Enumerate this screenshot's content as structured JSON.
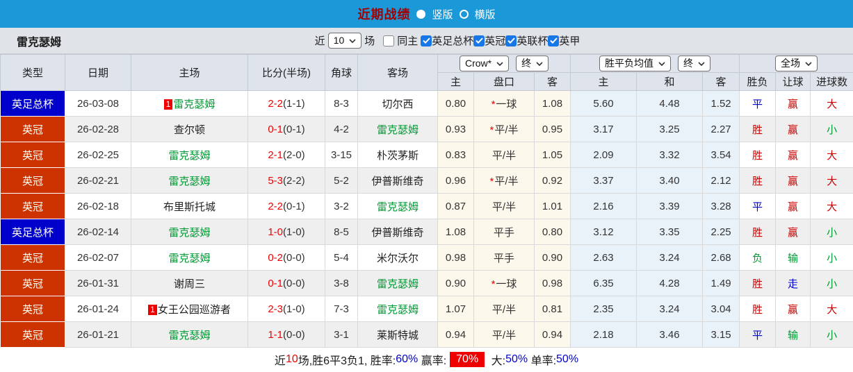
{
  "colors": {
    "topbar_blue": "#1b98d8",
    "title_red": "#a30000",
    "league_cup_blue": "#0000cc",
    "league_championship_red": "#cc3300",
    "team_highlight_green": "#009933",
    "score_red": "#ee0000",
    "result_red": "#cc0000",
    "result_blue": "#0000cc",
    "result_green": "#009933",
    "odds_cell_bg": "#fdf8ec",
    "avg_cell_bg": "#eaf2f9",
    "win_rate_badge_bg": "#ee0000"
  },
  "topbar": {
    "title": "近期战绩",
    "radio_vertical": "竖版",
    "radio_horizontal": "横版",
    "selected": "竖版"
  },
  "filter": {
    "team": "雷克瑟姆",
    "near_label": "近",
    "count_value": "10",
    "games_label": "场",
    "same_home_label": "同主",
    "same_home_checked": false,
    "leagues": [
      {
        "label": "英足总杯",
        "checked": true
      },
      {
        "label": "英冠",
        "checked": true
      },
      {
        "label": "英联杯",
        "checked": true
      },
      {
        "label": "英甲",
        "checked": true
      }
    ]
  },
  "table": {
    "main_headers": [
      "类型",
      "日期",
      "主场",
      "比分(半场)",
      "角球",
      "客场"
    ],
    "dropdowns": {
      "odds_company": "Crow*",
      "odds_final": "终",
      "avg_label": "胜平负均值",
      "avg_final": "终",
      "fulltime": "全场"
    },
    "sub_headers": [
      "主",
      "盘口",
      "客",
      "主",
      "和",
      "客",
      "胜负",
      "让球",
      "进球数"
    ],
    "rows": [
      {
        "league": "英足总杯",
        "league_type": "cup",
        "date": "26-03-08",
        "home": {
          "name": "雷克瑟姆",
          "rank": "1",
          "highlight": true
        },
        "score": "2-2",
        "half": "(1-1)",
        "corners": "8-3",
        "away": {
          "name": "切尔西",
          "rank": "",
          "highlight": false
        },
        "odds_home": "0.80",
        "handicap": {
          "text": "一球",
          "star": true
        },
        "odds_away": "1.08",
        "avg": [
          "5.60",
          "4.48",
          "1.52"
        ],
        "outcome": [
          {
            "t": "平",
            "c": "blue"
          },
          {
            "t": "赢",
            "c": "red"
          },
          {
            "t": "大",
            "c": "red"
          }
        ]
      },
      {
        "league": "英冠",
        "league_type": "chp",
        "date": "26-02-28",
        "home": {
          "name": "查尔顿",
          "rank": "",
          "highlight": false
        },
        "score": "0-1",
        "half": "(0-1)",
        "corners": "4-2",
        "away": {
          "name": "雷克瑟姆",
          "rank": "",
          "highlight": true
        },
        "odds_home": "0.93",
        "handicap": {
          "text": "平/半",
          "star": true
        },
        "odds_away": "0.95",
        "avg": [
          "3.17",
          "3.25",
          "2.27"
        ],
        "outcome": [
          {
            "t": "胜",
            "c": "red"
          },
          {
            "t": "赢",
            "c": "red"
          },
          {
            "t": "小",
            "c": "green"
          }
        ]
      },
      {
        "league": "英冠",
        "league_type": "chp",
        "date": "26-02-25",
        "home": {
          "name": "雷克瑟姆",
          "rank": "",
          "highlight": true
        },
        "score": "2-1",
        "half": "(2-0)",
        "corners": "3-15",
        "away": {
          "name": "朴茨茅斯",
          "rank": "",
          "highlight": false
        },
        "odds_home": "0.83",
        "handicap": {
          "text": "平/半",
          "star": false
        },
        "odds_away": "1.05",
        "avg": [
          "2.09",
          "3.32",
          "3.54"
        ],
        "outcome": [
          {
            "t": "胜",
            "c": "red"
          },
          {
            "t": "赢",
            "c": "red"
          },
          {
            "t": "大",
            "c": "red"
          }
        ]
      },
      {
        "league": "英冠",
        "league_type": "chp",
        "date": "26-02-21",
        "home": {
          "name": "雷克瑟姆",
          "rank": "",
          "highlight": true
        },
        "score": "5-3",
        "half": "(2-2)",
        "corners": "5-2",
        "away": {
          "name": "伊普斯维奇",
          "rank": "",
          "highlight": false
        },
        "odds_home": "0.96",
        "handicap": {
          "text": "平/半",
          "star": true
        },
        "odds_away": "0.92",
        "avg": [
          "3.37",
          "3.40",
          "2.12"
        ],
        "outcome": [
          {
            "t": "胜",
            "c": "red"
          },
          {
            "t": "赢",
            "c": "red"
          },
          {
            "t": "大",
            "c": "red"
          }
        ]
      },
      {
        "league": "英冠",
        "league_type": "chp",
        "date": "26-02-18",
        "home": {
          "name": "布里斯托城",
          "rank": "",
          "highlight": false
        },
        "score": "2-2",
        "half": "(0-1)",
        "corners": "3-2",
        "away": {
          "name": "雷克瑟姆",
          "rank": "",
          "highlight": true
        },
        "odds_home": "0.87",
        "handicap": {
          "text": "平/半",
          "star": false
        },
        "odds_away": "1.01",
        "avg": [
          "2.16",
          "3.39",
          "3.28"
        ],
        "outcome": [
          {
            "t": "平",
            "c": "blue"
          },
          {
            "t": "赢",
            "c": "red"
          },
          {
            "t": "大",
            "c": "red"
          }
        ]
      },
      {
        "league": "英足总杯",
        "league_type": "cup",
        "date": "26-02-14",
        "home": {
          "name": "雷克瑟姆",
          "rank": "",
          "highlight": true
        },
        "score": "1-0",
        "half": "(1-0)",
        "corners": "8-5",
        "away": {
          "name": "伊普斯维奇",
          "rank": "",
          "highlight": false
        },
        "odds_home": "1.08",
        "handicap": {
          "text": "平手",
          "star": false
        },
        "odds_away": "0.80",
        "avg": [
          "3.12",
          "3.35",
          "2.25"
        ],
        "outcome": [
          {
            "t": "胜",
            "c": "red"
          },
          {
            "t": "赢",
            "c": "red"
          },
          {
            "t": "小",
            "c": "green"
          }
        ]
      },
      {
        "league": "英冠",
        "league_type": "chp",
        "date": "26-02-07",
        "home": {
          "name": "雷克瑟姆",
          "rank": "",
          "highlight": true
        },
        "score": "0-2",
        "half": "(0-0)",
        "corners": "5-4",
        "away": {
          "name": "米尔沃尔",
          "rank": "",
          "highlight": false
        },
        "odds_home": "0.98",
        "handicap": {
          "text": "平手",
          "star": false
        },
        "odds_away": "0.90",
        "avg": [
          "2.63",
          "3.24",
          "2.68"
        ],
        "outcome": [
          {
            "t": "负",
            "c": "green"
          },
          {
            "t": "输",
            "c": "green"
          },
          {
            "t": "小",
            "c": "green"
          }
        ]
      },
      {
        "league": "英冠",
        "league_type": "chp",
        "date": "26-01-31",
        "home": {
          "name": "谢周三",
          "rank": "",
          "highlight": false
        },
        "score": "0-1",
        "half": "(0-0)",
        "corners": "3-8",
        "away": {
          "name": "雷克瑟姆",
          "rank": "",
          "highlight": true
        },
        "odds_home": "0.90",
        "handicap": {
          "text": "一球",
          "star": true
        },
        "odds_away": "0.98",
        "avg": [
          "6.35",
          "4.28",
          "1.49"
        ],
        "outcome": [
          {
            "t": "胜",
            "c": "red"
          },
          {
            "t": "走",
            "c": "blue"
          },
          {
            "t": "小",
            "c": "green"
          }
        ]
      },
      {
        "league": "英冠",
        "league_type": "chp",
        "date": "26-01-24",
        "home": {
          "name": "女王公园巡游者",
          "rank": "1",
          "highlight": false
        },
        "score": "2-3",
        "half": "(1-0)",
        "corners": "7-3",
        "away": {
          "name": "雷克瑟姆",
          "rank": "",
          "highlight": true
        },
        "odds_home": "1.07",
        "handicap": {
          "text": "平/半",
          "star": false
        },
        "odds_away": "0.81",
        "avg": [
          "2.35",
          "3.24",
          "3.04"
        ],
        "outcome": [
          {
            "t": "胜",
            "c": "red"
          },
          {
            "t": "赢",
            "c": "red"
          },
          {
            "t": "大",
            "c": "red"
          }
        ]
      },
      {
        "league": "英冠",
        "league_type": "chp",
        "date": "26-01-21",
        "home": {
          "name": "雷克瑟姆",
          "rank": "",
          "highlight": true
        },
        "score": "1-1",
        "half": "(0-0)",
        "corners": "3-1",
        "away": {
          "name": "莱斯特城",
          "rank": "",
          "highlight": false
        },
        "odds_home": "0.94",
        "handicap": {
          "text": "平/半",
          "star": false
        },
        "odds_away": "0.94",
        "avg": [
          "2.18",
          "3.46",
          "3.15"
        ],
        "outcome": [
          {
            "t": "平",
            "c": "blue"
          },
          {
            "t": "输",
            "c": "green"
          },
          {
            "t": "小",
            "c": "green"
          }
        ]
      }
    ]
  },
  "footer": {
    "segments": [
      {
        "text": "近",
        "style": "plain"
      },
      {
        "text": "10",
        "style": "red"
      },
      {
        "text": "场,胜6平3负1, 胜率:",
        "style": "plain"
      },
      {
        "text": "60%",
        "style": "blue"
      },
      {
        "text": " 赢率:",
        "style": "plain"
      },
      {
        "text": "70%",
        "style": "winbadge"
      },
      {
        "text": " 大:",
        "style": "plain"
      },
      {
        "text": "50%",
        "style": "blue"
      },
      {
        "text": " 单率:",
        "style": "plain"
      },
      {
        "text": "50%",
        "style": "blue"
      }
    ]
  }
}
